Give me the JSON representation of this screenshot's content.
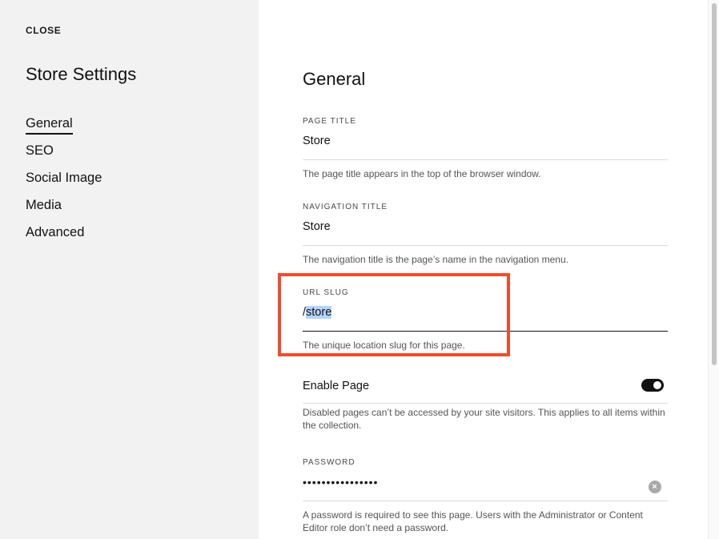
{
  "sidebar": {
    "close_label": "CLOSE",
    "title": "Store Settings",
    "items": [
      {
        "label": "General",
        "active": true
      },
      {
        "label": "SEO"
      },
      {
        "label": "Social Image"
      },
      {
        "label": "Media"
      },
      {
        "label": "Advanced"
      }
    ]
  },
  "main": {
    "title": "General",
    "page_title": {
      "label": "PAGE TITLE",
      "value": "Store",
      "help": "The page title appears in the top of the browser window."
    },
    "navigation_title": {
      "label": "NAVIGATION TITLE",
      "value": "Store",
      "help": "The navigation title is the page’s name in the navigation menu."
    },
    "url_slug": {
      "label": "URL SLUG",
      "prefix": "/",
      "selected": "store",
      "help": "The unique location slug for this page."
    },
    "enable_page": {
      "label": "Enable Page",
      "enabled": true,
      "help": "Disabled pages can’t be accessed by your site visitors. This applies to all items within the collection."
    },
    "password": {
      "label": "PASSWORD",
      "masked": "••••••••••••••••",
      "clear_icon": "×",
      "help": "A password is required to see this page. Users with the Administrator or Content Editor role don’t need a password."
    }
  },
  "colors": {
    "highlight": "#f24b2c",
    "selection": "#b3d4fd",
    "sidebar_bg": "#f2f2f2"
  }
}
